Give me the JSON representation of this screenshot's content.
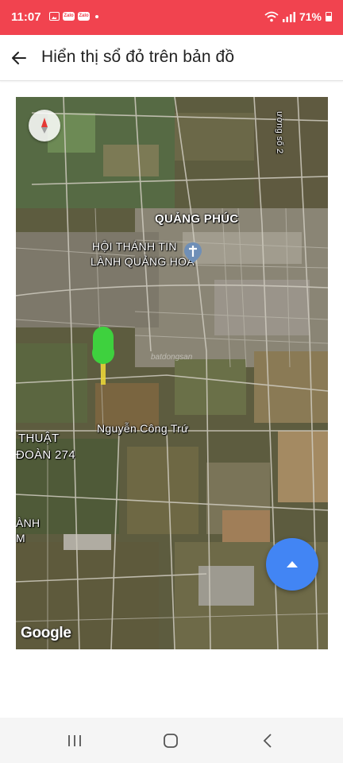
{
  "status_bar": {
    "time": "11:07",
    "notification_labels": [
      "Zalo",
      "Zalo"
    ],
    "battery": "71%",
    "background_color": "#f1434f"
  },
  "app_bar": {
    "title": "Hiển thị sổ đỏ trên bản đồ",
    "back_icon": "arrow-left-icon"
  },
  "map": {
    "labels": {
      "quang_phuc": "QUẢNG PHÚC",
      "church_line1": "HỘI THÁNH TIN",
      "church_line2": "LÀNH QUẢNG HOÀ",
      "road_nguyen_cong_tru": "Nguyễn Công Trứ",
      "thuat_line1": "THUẬT",
      "thuat_line2": "ĐOÀN 274",
      "edge_anh": "ÀNH",
      "edge_m": "M",
      "road_top_right": "ường số 2"
    },
    "watermark": "batdongsan",
    "attribution": "Google",
    "compass_icon": "compass-icon",
    "church_icon": "church-pin-icon",
    "marker_icon": "location-marker-icon",
    "marker_color": "#3ed13e",
    "fab_icon": "chevron-up-icon",
    "fab_color": "#4285f4"
  },
  "nav_bar": {
    "recents_icon": "recent-apps-icon",
    "home_icon": "home-icon",
    "back_icon": "back-nav-icon"
  }
}
